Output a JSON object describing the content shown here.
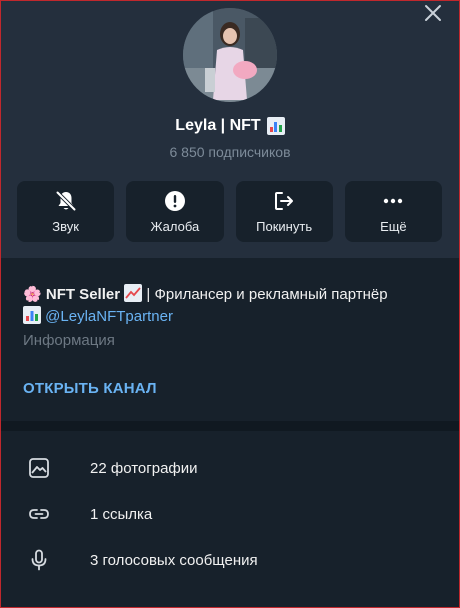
{
  "profile": {
    "name": "Leyla | NFT",
    "subscribers": "6 850 подписчиков"
  },
  "actions": [
    {
      "label": "Звук",
      "icon": "bell-off-icon"
    },
    {
      "label": "Жалоба",
      "icon": "alert-icon"
    },
    {
      "label": "Покинуть",
      "icon": "leave-icon"
    },
    {
      "label": "Ещё",
      "icon": "more-icon"
    }
  ],
  "info": {
    "bio_emoji": "🌸",
    "bio_title": "NFT Seller",
    "bio_rest": "| Фрилансер и рекламный партнёр",
    "bio_link": "@LeylaNFTpartner",
    "caption": "Информация",
    "open_channel": "ОТКРЫТЬ КАНАЛ"
  },
  "media": [
    {
      "label": "22 фотографии",
      "icon": "photo-icon"
    },
    {
      "label": "1 ссылка",
      "icon": "link-icon"
    },
    {
      "label": "3 голосовых сообщения",
      "icon": "microphone-icon"
    }
  ],
  "colors": {
    "background": "#17212b",
    "header": "#242f3d",
    "accent": "#6ab3f3",
    "muted": "#7d8b99"
  }
}
